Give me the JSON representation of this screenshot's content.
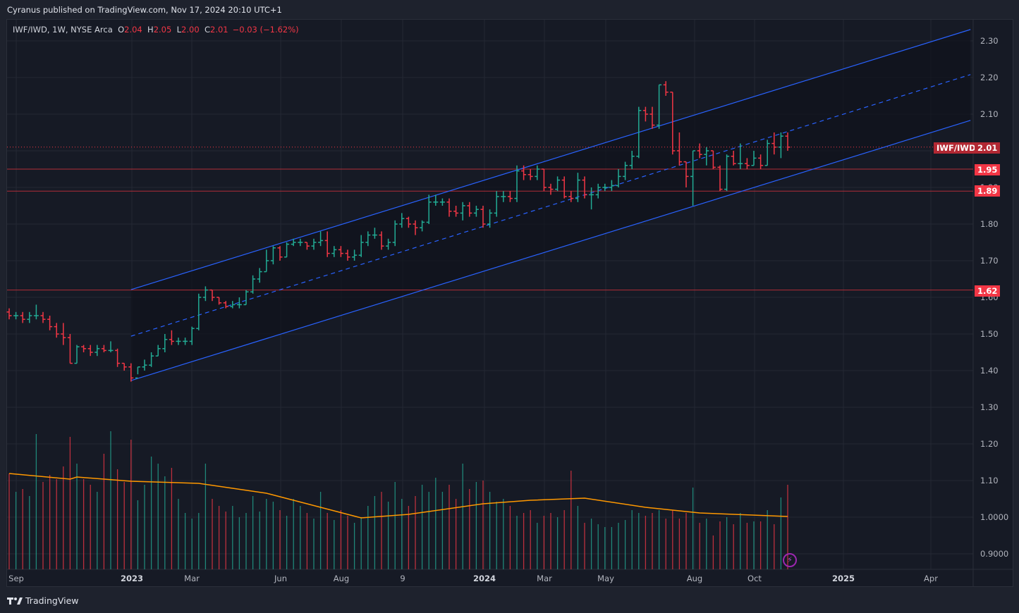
{
  "header": {
    "published": "Cyranus published on TradingView.com, Nov 17, 2024 20:10 UTC+1"
  },
  "legend": {
    "symbol": "IWF/IWD, 1W, NYSE Arca",
    "o_label": "O",
    "o": "2.04",
    "h_label": "H",
    "h": "2.05",
    "l_label": "L",
    "l": "2.00",
    "c_label": "C",
    "c": "2.01",
    "change": "−0.03 (−1.62%)"
  },
  "badges": {
    "symbol": "IWF/IWD",
    "last": "2.01",
    "line1": "1.95",
    "line2": "1.89",
    "line3": "1.62"
  },
  "footer": {
    "brand": "TradingView"
  },
  "colors": {
    "up": "#22ab94",
    "down": "#f23645",
    "channel": "#2962ff",
    "hline": "#c2303a",
    "ma": "#ff9800",
    "background": "#161a25"
  },
  "icons": {
    "flash": "lightning-icon",
    "logo": "tradingview-logo-icon"
  },
  "chart_data": {
    "type": "ohlc",
    "symbol": "IWF/IWD",
    "interval": "1W",
    "y_ticks": [
      "2.30",
      "2.20",
      "2.10",
      "2.00",
      "1.90",
      "1.80",
      "1.70",
      "1.60",
      "1.50",
      "1.40",
      "1.30",
      "1.20",
      "1.10",
      "1.0000",
      "0.9000"
    ],
    "x_ticks": [
      "Sep",
      "2023",
      "Mar",
      "Jun",
      "Aug",
      "9",
      "2024",
      "Mar",
      "May",
      "Aug",
      "Oct",
      "2025",
      "Apr"
    ],
    "ylim": [
      0.86,
      2.36
    ],
    "grid": true,
    "open": [
      1.56,
      1.55,
      1.55,
      1.54,
      1.55,
      1.55,
      1.54,
      1.52,
      1.5,
      1.49,
      1.42,
      1.465,
      1.46,
      1.45,
      1.46,
      1.455,
      1.455,
      1.42,
      1.41,
      1.38,
      1.41,
      1.415,
      1.44,
      1.46,
      1.485,
      1.48,
      1.48,
      1.48,
      1.515,
      1.6,
      1.62,
      1.6,
      1.585,
      1.575,
      1.58,
      1.58,
      1.615,
      1.65,
      1.67,
      1.7,
      1.735,
      1.71,
      1.745,
      1.75,
      1.75,
      1.74,
      1.75,
      1.755,
      1.72,
      1.73,
      1.72,
      1.71,
      1.715,
      1.75,
      1.77,
      1.77,
      1.74,
      1.75,
      1.8,
      1.815,
      1.8,
      1.79,
      1.805,
      1.86,
      1.86,
      1.86,
      1.835,
      1.83,
      1.85,
      1.83,
      1.84,
      1.8,
      1.83,
      1.875,
      1.875,
      1.87,
      1.945,
      1.935,
      1.93,
      1.95,
      1.9,
      1.895,
      1.92,
      1.875,
      1.87,
      1.92,
      1.88,
      1.88,
      1.9,
      1.9,
      1.905,
      1.93,
      1.96,
      1.985,
      2.11,
      2.1,
      2.07,
      2.18,
      2.16,
      2.0,
      1.97,
      1.93,
      2.0,
      1.99,
      2.0,
      1.955,
      1.895,
      1.985,
      1.965,
      1.965,
      1.96,
      1.98,
      1.96,
      2.02,
      2.01,
      2.04
    ],
    "high": [
      1.57,
      1.56,
      1.56,
      1.56,
      1.58,
      1.56,
      1.55,
      1.53,
      1.53,
      1.5,
      1.47,
      1.47,
      1.47,
      1.47,
      1.47,
      1.48,
      1.46,
      1.42,
      1.42,
      1.41,
      1.43,
      1.45,
      1.47,
      1.5,
      1.51,
      1.49,
      1.49,
      1.52,
      1.61,
      1.63,
      1.62,
      1.6,
      1.59,
      1.59,
      1.6,
      1.62,
      1.66,
      1.68,
      1.73,
      1.74,
      1.74,
      1.75,
      1.76,
      1.76,
      1.75,
      1.76,
      1.78,
      1.78,
      1.74,
      1.74,
      1.73,
      1.73,
      1.77,
      1.78,
      1.79,
      1.78,
      1.76,
      1.81,
      1.83,
      1.82,
      1.81,
      1.81,
      1.88,
      1.88,
      1.87,
      1.87,
      1.85,
      1.86,
      1.86,
      1.85,
      1.85,
      1.84,
      1.89,
      1.89,
      1.89,
      1.96,
      1.96,
      1.95,
      1.96,
      1.95,
      1.91,
      1.93,
      1.93,
      1.89,
      1.94,
      1.93,
      1.9,
      1.91,
      1.91,
      1.92,
      1.95,
      1.97,
      2.0,
      2.12,
      2.12,
      2.12,
      2.18,
      2.19,
      2.16,
      2.05,
      1.97,
      2.0,
      2.02,
      2.01,
      2.0,
      1.96,
      1.99,
      2.0,
      2.02,
      1.98,
      2.0,
      1.99,
      2.03,
      2.05,
      2.05,
      2.05
    ],
    "low": [
      1.54,
      1.54,
      1.53,
      1.53,
      1.54,
      1.53,
      1.51,
      1.49,
      1.47,
      1.42,
      1.42,
      1.45,
      1.44,
      1.44,
      1.45,
      1.45,
      1.41,
      1.4,
      1.37,
      1.39,
      1.4,
      1.41,
      1.44,
      1.45,
      1.47,
      1.47,
      1.47,
      1.47,
      1.51,
      1.59,
      1.59,
      1.58,
      1.57,
      1.57,
      1.57,
      1.58,
      1.61,
      1.64,
      1.67,
      1.69,
      1.7,
      1.71,
      1.74,
      1.74,
      1.73,
      1.73,
      1.74,
      1.71,
      1.71,
      1.71,
      1.7,
      1.7,
      1.71,
      1.74,
      1.76,
      1.73,
      1.73,
      1.74,
      1.79,
      1.79,
      1.77,
      1.78,
      1.8,
      1.85,
      1.85,
      1.82,
      1.82,
      1.81,
      1.82,
      1.82,
      1.79,
      1.79,
      1.82,
      1.86,
      1.86,
      1.86,
      1.92,
      1.92,
      1.92,
      1.89,
      1.88,
      1.89,
      1.87,
      1.86,
      1.86,
      1.87,
      1.84,
      1.87,
      1.89,
      1.89,
      1.9,
      1.92,
      1.95,
      1.98,
      2.08,
      2.06,
      2.06,
      2.15,
      1.99,
      1.96,
      1.9,
      1.85,
      1.98,
      1.96,
      1.95,
      1.89,
      1.89,
      1.96,
      1.95,
      1.95,
      1.96,
      1.95,
      1.96,
      1.99,
      1.98,
      2.0
    ],
    "close": [
      1.55,
      1.55,
      1.54,
      1.55,
      1.55,
      1.54,
      1.52,
      1.5,
      1.49,
      1.42,
      1.465,
      1.46,
      1.45,
      1.46,
      1.455,
      1.455,
      1.42,
      1.41,
      1.38,
      1.41,
      1.415,
      1.44,
      1.46,
      1.485,
      1.48,
      1.48,
      1.48,
      1.515,
      1.6,
      1.62,
      1.6,
      1.585,
      1.575,
      1.58,
      1.58,
      1.615,
      1.65,
      1.67,
      1.7,
      1.735,
      1.71,
      1.745,
      1.75,
      1.75,
      1.74,
      1.75,
      1.755,
      1.72,
      1.73,
      1.72,
      1.71,
      1.715,
      1.75,
      1.77,
      1.77,
      1.74,
      1.75,
      1.8,
      1.815,
      1.8,
      1.79,
      1.805,
      1.86,
      1.86,
      1.86,
      1.835,
      1.83,
      1.85,
      1.83,
      1.84,
      1.8,
      1.83,
      1.875,
      1.875,
      1.87,
      1.945,
      1.935,
      1.93,
      1.95,
      1.9,
      1.895,
      1.92,
      1.875,
      1.87,
      1.92,
      1.88,
      1.88,
      1.9,
      1.9,
      1.905,
      1.93,
      1.96,
      1.985,
      2.11,
      2.1,
      2.07,
      2.18,
      2.16,
      2.0,
      1.97,
      1.93,
      2.0,
      1.99,
      2.0,
      1.955,
      1.895,
      1.985,
      1.965,
      1.965,
      1.96,
      1.98,
      1.96,
      2.02,
      2.01,
      2.04,
      2.01
    ],
    "volume_relative": [
      0.68,
      0.55,
      0.57,
      0.52,
      0.96,
      0.62,
      0.67,
      0.64,
      0.73,
      0.94,
      0.75,
      0.64,
      0.6,
      0.55,
      0.82,
      0.98,
      0.71,
      0.62,
      0.92,
      0.49,
      0.6,
      0.8,
      0.75,
      0.66,
      0.72,
      0.5,
      0.4,
      0.36,
      0.4,
      0.75,
      0.5,
      0.45,
      0.41,
      0.45,
      0.37,
      0.4,
      0.52,
      0.41,
      0.5,
      0.48,
      0.42,
      0.38,
      0.5,
      0.45,
      0.4,
      0.36,
      0.55,
      0.4,
      0.35,
      0.42,
      0.38,
      0.33,
      0.37,
      0.45,
      0.52,
      0.55,
      0.48,
      0.62,
      0.5,
      0.45,
      0.52,
      0.6,
      0.55,
      0.65,
      0.55,
      0.6,
      0.5,
      0.75,
      0.57,
      0.62,
      0.63,
      0.55,
      0.48,
      0.5,
      0.45,
      0.38,
      0.4,
      0.42,
      0.33,
      0.38,
      0.4,
      0.37,
      0.42,
      0.7,
      0.45,
      0.33,
      0.36,
      0.32,
      0.3,
      0.3,
      0.33,
      0.35,
      0.42,
      0.4,
      0.38,
      0.4,
      0.42,
      0.36,
      0.42,
      0.36,
      0.4,
      0.58,
      0.33,
      0.36,
      0.24,
      0.34,
      0.37,
      0.32,
      0.4,
      0.33,
      0.34,
      0.34,
      0.42,
      0.32,
      0.51,
      0.6
    ],
    "volume_ma_relative": [
      [
        0,
        0.68
      ],
      [
        9,
        0.64
      ],
      [
        10,
        0.655
      ],
      [
        18,
        0.625
      ],
      [
        28,
        0.61
      ],
      [
        38,
        0.54
      ],
      [
        46,
        0.44
      ],
      [
        52,
        0.365
      ],
      [
        59,
        0.39
      ],
      [
        70,
        0.465
      ],
      [
        77,
        0.49
      ],
      [
        85,
        0.505
      ],
      [
        94,
        0.44
      ],
      [
        102,
        0.4
      ],
      [
        115,
        0.375
      ]
    ],
    "horizontal_lines": [
      1.95,
      1.89,
      1.62
    ],
    "last_price": 2.01,
    "channel": {
      "start_bar": 18,
      "end_bar": 142,
      "upper": [
        1.621,
        2.331
      ],
      "middle": [
        1.494,
        2.208
      ],
      "lower": [
        1.373,
        2.083
      ]
    }
  }
}
